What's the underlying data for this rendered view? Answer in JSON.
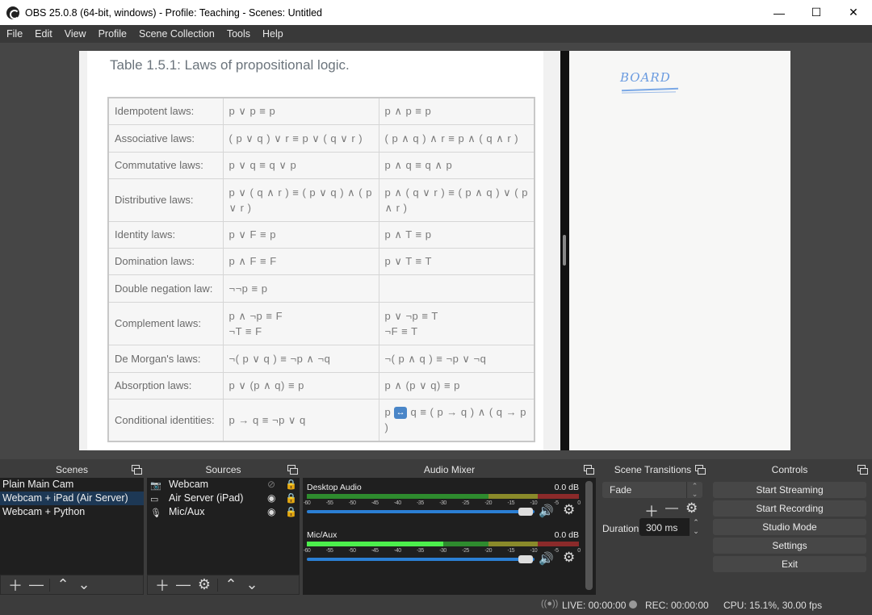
{
  "window": {
    "title": "OBS 25.0.8 (64-bit, windows) - Profile: Teaching - Scenes: Untitled",
    "controls": {
      "minimize": "—",
      "maximize": "☐",
      "close": "✕"
    }
  },
  "menu": [
    "File",
    "Edit",
    "View",
    "Profile",
    "Scene Collection",
    "Tools",
    "Help"
  ],
  "preview": {
    "doc_title": "Table 1.5.1: Laws of propositional logic.",
    "laws": [
      {
        "label": "Idempotent laws:",
        "left": "p ∨ p ≡ p",
        "right": "p ∧ p ≡ p"
      },
      {
        "label": "Associative laws:",
        "left": "( p ∨ q ) ∨ r ≡ p ∨ ( q ∨ r )",
        "right": "( p ∧ q ) ∧ r ≡ p ∧ ( q ∧ r )"
      },
      {
        "label": "Commutative laws:",
        "left": "p ∨ q ≡ q ∨ p",
        "right": "p ∧ q ≡ q ∧ p"
      },
      {
        "label": "Distributive laws:",
        "left": "p ∨ ( q ∧ r ) ≡ ( p ∨ q ) ∧ ( p ∨ r )",
        "right": "p ∧ ( q ∨ r ) ≡ ( p ∧ q ) ∨ ( p ∧ r )"
      },
      {
        "label": "Identity laws:",
        "left": "p ∨ F ≡ p",
        "right": "p ∧ T ≡ p"
      },
      {
        "label": "Domination laws:",
        "left": "p ∧ F ≡ F",
        "right": "p ∨ T ≡ T"
      },
      {
        "label": "Double negation law:",
        "left": "¬¬p ≡ p",
        "right": ""
      },
      {
        "label": "Complement laws:",
        "left": "p ∧ ¬p ≡ F",
        "left2": "¬T ≡ F",
        "right": "p ∨ ¬p ≡ T",
        "right2": "¬F ≡ T"
      },
      {
        "label": "De Morgan's laws:",
        "left": "¬( p ∨ q ) ≡ ¬p ∧ ¬q",
        "right": "¬( p ∧ q ) ≡ ¬p ∨ ¬q"
      },
      {
        "label": "Absorption laws:",
        "left": "p ∨ (p ∧ q) ≡ p",
        "right": "p ∧ (p ∨ q) ≡ p"
      },
      {
        "label": "Conditional identities:",
        "left": "p → q ≡ ¬p ∨ q",
        "right_pre": "p",
        "right_icon": "↔",
        "right": "q ≡ ( p → q ) ∧ ( q → p )"
      }
    ],
    "board_text": "BOARD"
  },
  "scenes": {
    "title": "Scenes",
    "items": [
      "Plain Main Cam",
      "Webcam + iPad (Air Server)",
      "Webcam + Python"
    ],
    "selected": 1
  },
  "sources": {
    "title": "Sources",
    "items": [
      {
        "name": "Webcam",
        "icon": "camera-icon",
        "visible": false,
        "locked": true
      },
      {
        "name": "Air Server (iPad)",
        "icon": "window-icon",
        "visible": true,
        "locked": true
      },
      {
        "name": "Mic/Aux",
        "icon": "microphone-icon",
        "visible": true,
        "locked": true
      }
    ]
  },
  "mixer": {
    "title": "Audio Mixer",
    "ticks": [
      "-60",
      "-55",
      "-50",
      "-45",
      "-40",
      "-35",
      "-30",
      "-25",
      "-20",
      "-15",
      "-10",
      "-5",
      "0"
    ],
    "channels": [
      {
        "name": "Desktop Audio",
        "db": "0.0 dB",
        "level_db": -60,
        "volume": 0.96
      },
      {
        "name": "Mic/Aux",
        "db": "0.0 dB",
        "level_db": -30,
        "volume": 0.96
      }
    ]
  },
  "transitions": {
    "title": "Scene Transitions",
    "selected": "Fade",
    "duration_label": "Duration",
    "duration_value": "300 ms"
  },
  "controls": {
    "title": "Controls",
    "buttons": [
      "Start Streaming",
      "Start Recording",
      "Studio Mode",
      "Settings",
      "Exit"
    ]
  },
  "status": {
    "live": "LIVE: 00:00:00",
    "rec": "REC: 00:00:00",
    "cpu": "CPU: 15.1%, 30.00 fps"
  },
  "colors": {
    "meter_green": "#2e8b2e",
    "meter_yellow": "#8a8a2a",
    "meter_red": "#8b2a2a",
    "meter_active": "#4cef4c",
    "slider_blue": "#2b7fd4",
    "selection": "#1d3855"
  }
}
